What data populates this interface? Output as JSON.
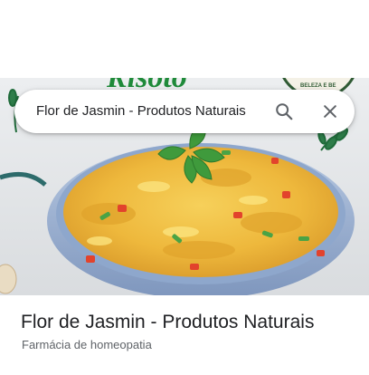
{
  "search": {
    "query": "Flor de Jasmin - Produtos Naturais"
  },
  "place": {
    "name": "Flor de Jasmin - Produtos Naturais",
    "category": "Farmácia de homeopatia"
  },
  "hero": {
    "partial_title": "Risoto",
    "partial_seal": "BELEZA E BE"
  },
  "colors": {
    "title_green": "#1f8a3a",
    "text_primary": "#202124",
    "text_secondary": "#5f6368",
    "icon_grey": "#5f6368",
    "pan_blue": "#9fb6d8"
  },
  "icons": {
    "search": "search-icon",
    "close": "close-icon"
  }
}
